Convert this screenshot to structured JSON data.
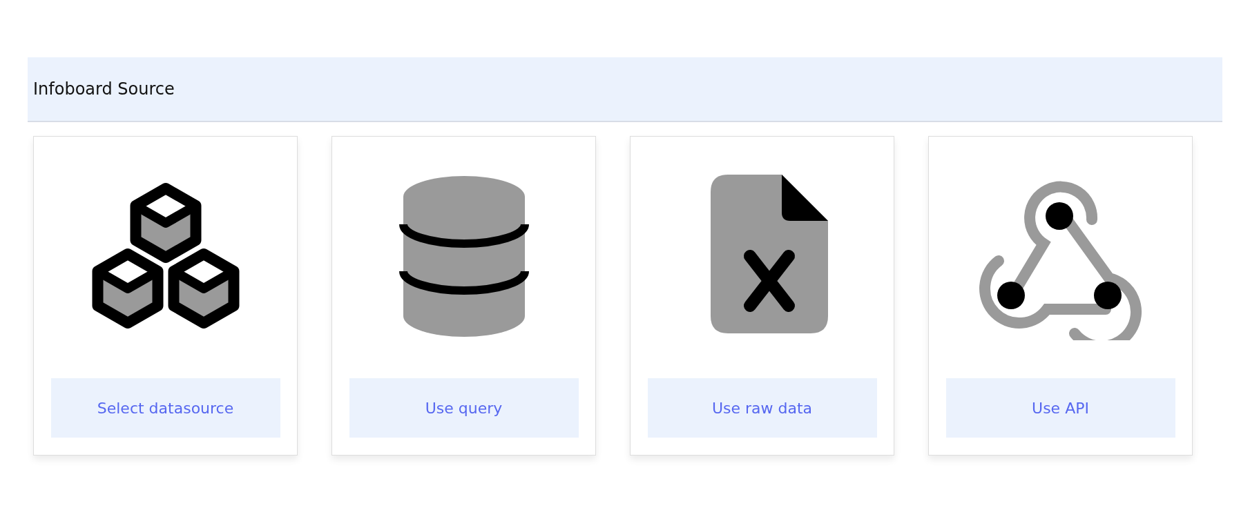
{
  "header": {
    "title": "Infoboard Source"
  },
  "options": [
    {
      "kind": "datasource",
      "label": "Select datasource"
    },
    {
      "kind": "query",
      "label": "Use query"
    },
    {
      "kind": "raw",
      "label": "Use raw data"
    },
    {
      "kind": "api",
      "label": "Use API"
    }
  ]
}
